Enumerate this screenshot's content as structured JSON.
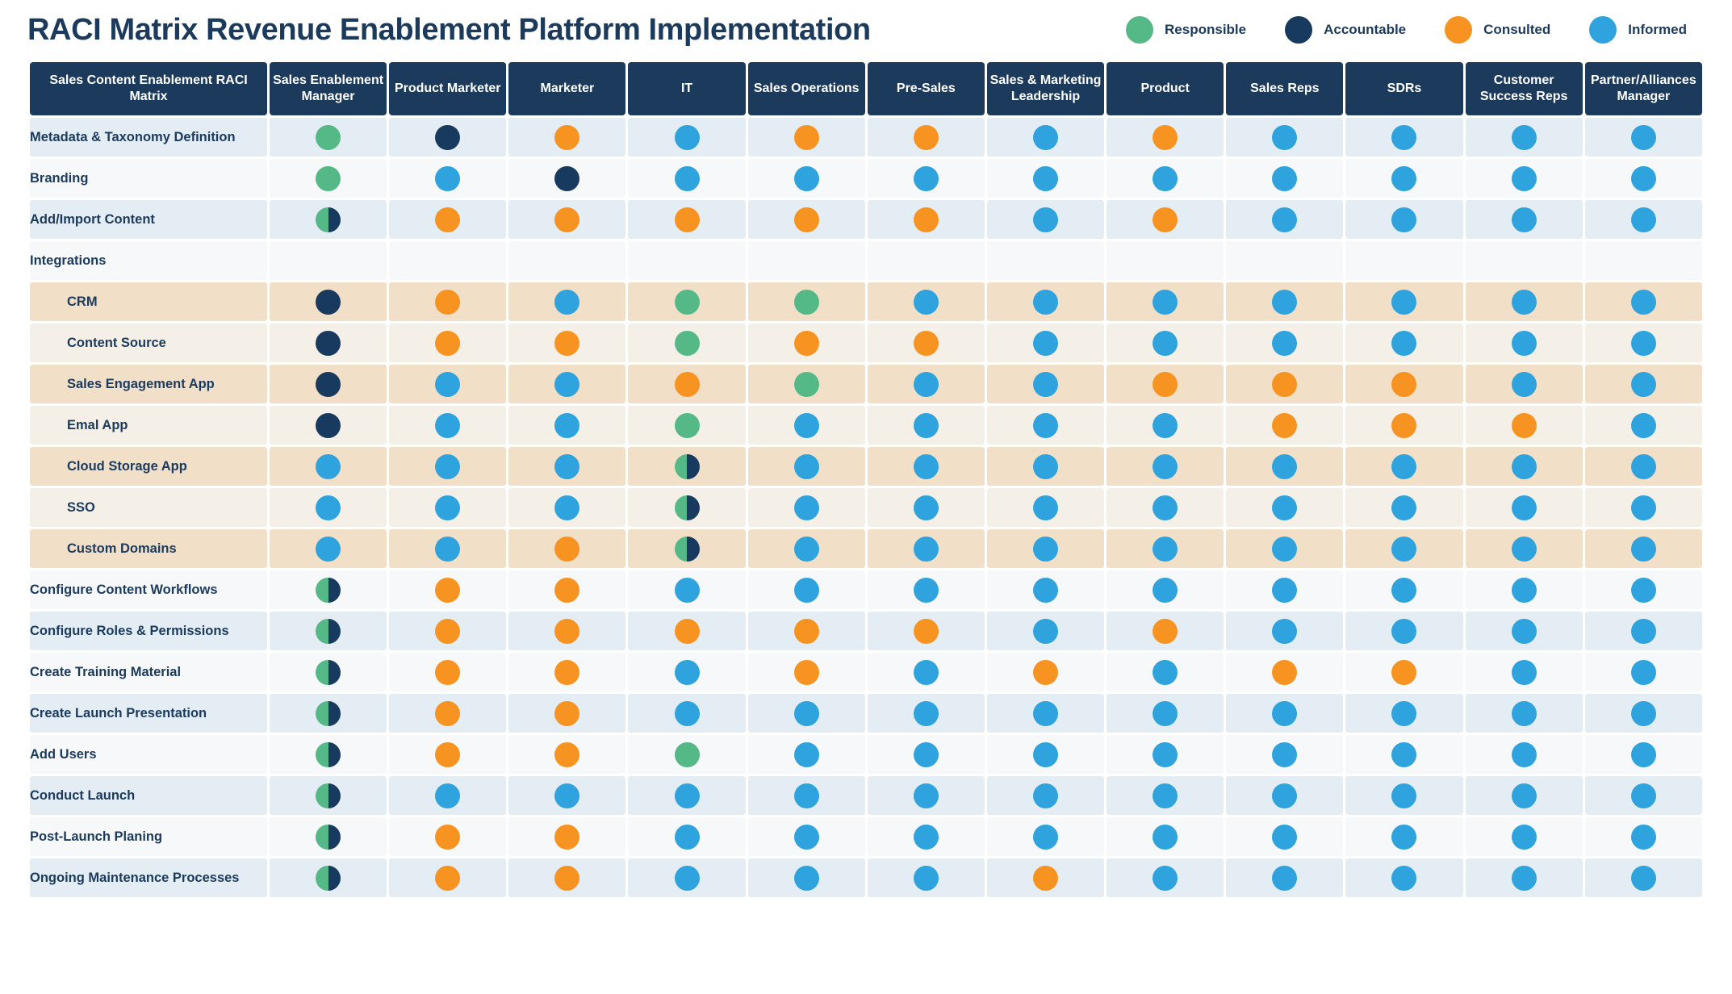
{
  "header": {
    "title": "RACI Matrix Revenue Enablement Platform Implementation"
  },
  "legend": {
    "items": [
      {
        "label": "Responsible",
        "key": "R",
        "color": "#55b987"
      },
      {
        "label": "Accountable",
        "key": "A",
        "color": "#173a5e"
      },
      {
        "label": "Consulted",
        "key": "C",
        "color": "#f79421"
      },
      {
        "label": "Informed",
        "key": "I",
        "color": "#2ea3dd"
      }
    ]
  },
  "colors": {
    "responsible": "#55b987",
    "accountable": "#173a5e",
    "consulted": "#f79421",
    "informed": "#2ea3dd",
    "header_bg": "#1b3a5c",
    "text_navy": "#1b3a5c",
    "row_blue": "#e4ecf4",
    "row_white": "#f6f8fa",
    "row_peach": "#f2dfc8",
    "row_cream": "#f4f0e7"
  },
  "table": {
    "corner_header": "Sales Content Enablement RACI Matrix",
    "columns": [
      "Sales Enablement Manager",
      "Product Marketer",
      "Marketer",
      "IT",
      "Sales Operations",
      "Pre-Sales",
      "Sales & Marketing Leadership",
      "Product",
      "Sales Reps",
      "SDRs",
      "Customer Success Reps",
      "Partner/Alliances Manager"
    ],
    "rows": [
      {
        "label": "Metadata & Taxonomy Definition",
        "indent": false,
        "tint": "blue",
        "values": [
          "R",
          "A",
          "C",
          "I",
          "C",
          "C",
          "I",
          "C",
          "I",
          "I",
          "I",
          "I"
        ]
      },
      {
        "label": "Branding",
        "indent": false,
        "tint": "white",
        "values": [
          "R",
          "I",
          "A",
          "I",
          "I",
          "I",
          "I",
          "I",
          "I",
          "I",
          "I",
          "I"
        ]
      },
      {
        "label": "Add/Import Content",
        "indent": false,
        "tint": "blue",
        "values": [
          "RA",
          "C",
          "C",
          "C",
          "C",
          "C",
          "I",
          "C",
          "I",
          "I",
          "I",
          "I"
        ]
      },
      {
        "label": "Integrations",
        "indent": false,
        "tint": "plain",
        "values": [
          "",
          "",
          "",
          "",
          "",
          "",
          "",
          "",
          "",
          "",
          "",
          ""
        ]
      },
      {
        "label": "CRM",
        "indent": true,
        "tint": "peach",
        "values": [
          "A",
          "C",
          "I",
          "R",
          "R",
          "I",
          "I",
          "I",
          "I",
          "I",
          "I",
          "I"
        ]
      },
      {
        "label": "Content Source",
        "indent": true,
        "tint": "cream",
        "values": [
          "A",
          "C",
          "C",
          "R",
          "C",
          "C",
          "I",
          "I",
          "I",
          "I",
          "I",
          "I"
        ]
      },
      {
        "label": "Sales Engagement App",
        "indent": true,
        "tint": "peach",
        "values": [
          "A",
          "I",
          "I",
          "C",
          "R",
          "I",
          "I",
          "C",
          "C",
          "C",
          "I",
          "I"
        ]
      },
      {
        "label": "Emal App",
        "indent": true,
        "tint": "cream",
        "values": [
          "A",
          "I",
          "I",
          "R",
          "I",
          "I",
          "I",
          "I",
          "C",
          "C",
          "C",
          "I"
        ]
      },
      {
        "label": "Cloud Storage App",
        "indent": true,
        "tint": "peach",
        "values": [
          "I",
          "I",
          "I",
          "RA",
          "I",
          "I",
          "I",
          "I",
          "I",
          "I",
          "I",
          "I"
        ]
      },
      {
        "label": "SSO",
        "indent": true,
        "tint": "cream",
        "values": [
          "I",
          "I",
          "I",
          "RA",
          "I",
          "I",
          "I",
          "I",
          "I",
          "I",
          "I",
          "I"
        ]
      },
      {
        "label": "Custom Domains",
        "indent": true,
        "tint": "peach",
        "values": [
          "I",
          "I",
          "C",
          "RA",
          "I",
          "I",
          "I",
          "I",
          "I",
          "I",
          "I",
          "I"
        ]
      },
      {
        "label": "Configure Content Workflows",
        "indent": false,
        "tint": "white",
        "values": [
          "RA",
          "C",
          "C",
          "I",
          "I",
          "I",
          "I",
          "I",
          "I",
          "I",
          "I",
          "I"
        ]
      },
      {
        "label": "Configure Roles & Permissions",
        "indent": false,
        "tint": "blue",
        "values": [
          "RA",
          "C",
          "C",
          "C",
          "C",
          "C",
          "I",
          "C",
          "I",
          "I",
          "I",
          "I"
        ]
      },
      {
        "label": "Create Training Material",
        "indent": false,
        "tint": "white",
        "values": [
          "RA",
          "C",
          "C",
          "I",
          "C",
          "I",
          "C",
          "I",
          "C",
          "C",
          "I",
          "I"
        ]
      },
      {
        "label": "Create Launch Presentation",
        "indent": false,
        "tint": "blue",
        "values": [
          "RA",
          "C",
          "C",
          "I",
          "I",
          "I",
          "I",
          "I",
          "I",
          "I",
          "I",
          "I"
        ]
      },
      {
        "label": "Add Users",
        "indent": false,
        "tint": "white",
        "values": [
          "RA",
          "C",
          "C",
          "R",
          "I",
          "I",
          "I",
          "I",
          "I",
          "I",
          "I",
          "I"
        ]
      },
      {
        "label": "Conduct Launch",
        "indent": false,
        "tint": "blue",
        "values": [
          "RA",
          "I",
          "I",
          "I",
          "I",
          "I",
          "I",
          "I",
          "I",
          "I",
          "I",
          "I"
        ]
      },
      {
        "label": "Post-Launch Planing",
        "indent": false,
        "tint": "white",
        "values": [
          "RA",
          "C",
          "C",
          "I",
          "I",
          "I",
          "I",
          "I",
          "I",
          "I",
          "I",
          "I"
        ]
      },
      {
        "label": "Ongoing Maintenance Processes",
        "indent": false,
        "tint": "blue",
        "values": [
          "RA",
          "C",
          "C",
          "I",
          "I",
          "I",
          "C",
          "I",
          "I",
          "I",
          "I",
          "I"
        ]
      }
    ]
  }
}
